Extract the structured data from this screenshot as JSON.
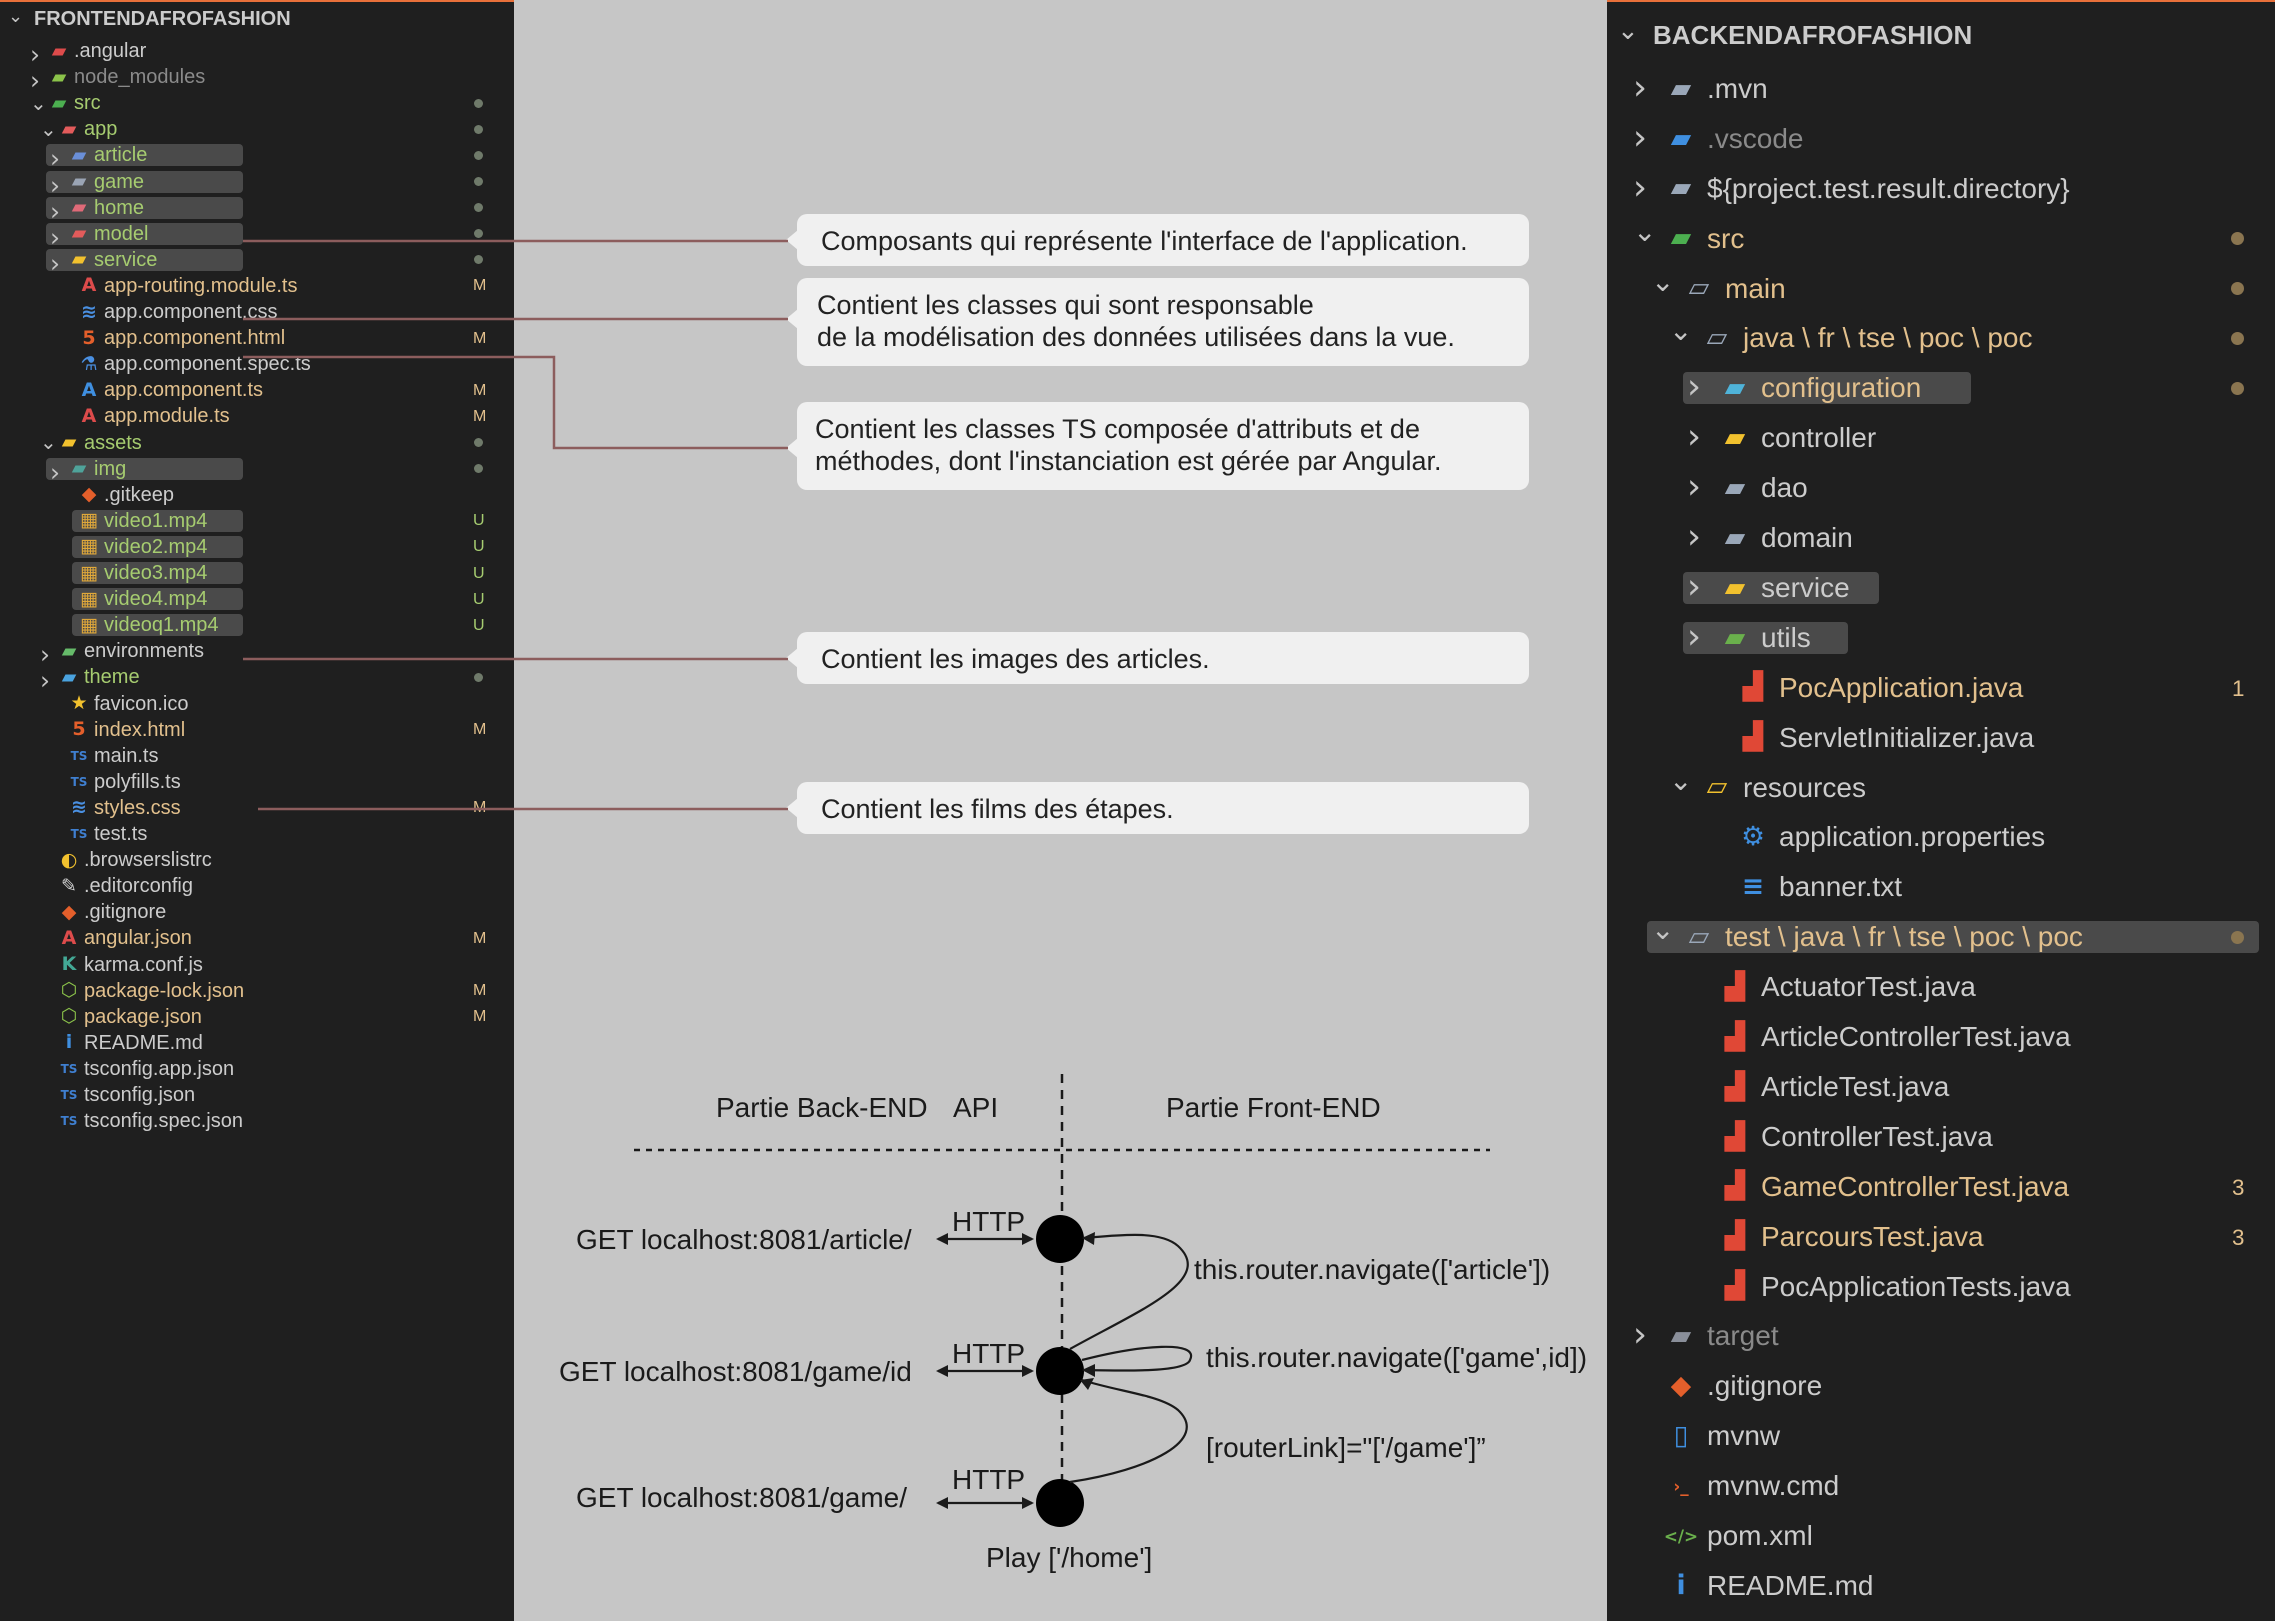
{
  "left_explorer": {
    "title": "FRONTENDAFROFASHION",
    "items": [
      {
        "label": ".angular",
        "indent": 1,
        "chevron": "right",
        "icon": "angular-folder-icon"
      },
      {
        "label": "node_modules",
        "indent": 1,
        "chevron": "right",
        "icon": "node-folder-icon",
        "dim": true
      },
      {
        "label": "src",
        "indent": 1,
        "chevron": "down",
        "icon": "src-folder-icon",
        "dot": true,
        "color": "#a6cc70"
      },
      {
        "label": "app",
        "indent": 2,
        "chevron": "down",
        "icon": "app-folder-icon",
        "dot": true,
        "color": "#a6cc70"
      },
      {
        "label": "article",
        "indent": 3,
        "chevron": "right",
        "icon": "article-folder-icon",
        "dot": true,
        "hl": true,
        "color": "#a6cc70"
      },
      {
        "label": "game",
        "indent": 3,
        "chevron": "right",
        "icon": "game-folder-icon",
        "dot": true,
        "hl": true,
        "color": "#a6cc70"
      },
      {
        "label": "home",
        "indent": 3,
        "chevron": "right",
        "icon": "home-folder-icon",
        "dot": true,
        "hl": true,
        "color": "#a6cc70"
      },
      {
        "label": "model",
        "indent": 3,
        "chevron": "right",
        "icon": "model-folder-icon",
        "dot": true,
        "hl": true,
        "color": "#a6cc70"
      },
      {
        "label": "service",
        "indent": 3,
        "chevron": "right",
        "icon": "service-folder-icon",
        "dot": true,
        "hl": true,
        "color": "#a6cc70"
      },
      {
        "label": "app-routing.module.ts",
        "indent": 4,
        "icon": "angular-icon",
        "badge": "M",
        "color": "#e2c08d"
      },
      {
        "label": "app.component.css",
        "indent": 4,
        "icon": "css-icon"
      },
      {
        "label": "app.component.html",
        "indent": 4,
        "icon": "html-icon",
        "badge": "M",
        "color": "#e2c08d"
      },
      {
        "label": "app.component.spec.ts",
        "indent": 4,
        "icon": "test-flask-icon"
      },
      {
        "label": "app.component.ts",
        "indent": 4,
        "icon": "angular-component-icon",
        "badge": "M",
        "color": "#e2c08d"
      },
      {
        "label": "app.module.ts",
        "indent": 4,
        "icon": "angular-icon",
        "badge": "M",
        "color": "#e2c08d"
      },
      {
        "label": "assets",
        "indent": 2,
        "chevron": "down",
        "icon": "assets-folder-icon",
        "dot": true,
        "color": "#a6cc70"
      },
      {
        "label": "img",
        "indent": 3,
        "chevron": "right",
        "icon": "images-folder-icon",
        "dot": true,
        "hl": true,
        "color": "#a6cc70"
      },
      {
        "label": ".gitkeep",
        "indent": 4,
        "icon": "git-icon"
      },
      {
        "label": "video1.mp4",
        "indent": 4,
        "icon": "video-icon",
        "badge": "U",
        "hl": true,
        "color": "#a6cc70"
      },
      {
        "label": "video2.mp4",
        "indent": 4,
        "icon": "video-icon",
        "badge": "U",
        "hl": true,
        "color": "#a6cc70"
      },
      {
        "label": "video3.mp4",
        "indent": 4,
        "icon": "video-icon",
        "badge": "U",
        "hl": true,
        "color": "#a6cc70"
      },
      {
        "label": "video4.mp4",
        "indent": 4,
        "icon": "video-icon",
        "badge": "U",
        "hl": true,
        "color": "#a6cc70"
      },
      {
        "label": "videoq1.mp4",
        "indent": 4,
        "icon": "video-icon",
        "badge": "U",
        "hl": true,
        "color": "#a6cc70"
      },
      {
        "label": "environments",
        "indent": 2,
        "chevron": "right",
        "icon": "environment-folder-icon"
      },
      {
        "label": "theme",
        "indent": 2,
        "chevron": "right",
        "icon": "theme-folder-icon",
        "dot": true,
        "color": "#a6cc70"
      },
      {
        "label": "favicon.ico",
        "indent": 3,
        "icon": "star-icon"
      },
      {
        "label": "index.html",
        "indent": 3,
        "icon": "html-icon",
        "badge": "M",
        "color": "#e2c08d"
      },
      {
        "label": "main.ts",
        "indent": 3,
        "icon": "typescript-icon"
      },
      {
        "label": "polyfills.ts",
        "indent": 3,
        "icon": "typescript-icon"
      },
      {
        "label": "styles.css",
        "indent": 3,
        "icon": "css-icon",
        "badge": "M",
        "color": "#e2c08d"
      },
      {
        "label": "test.ts",
        "indent": 3,
        "icon": "typescript-icon"
      },
      {
        "label": ".browserslistrc",
        "indent": 2,
        "icon": "browserslist-icon"
      },
      {
        "label": ".editorconfig",
        "indent": 2,
        "icon": "editorconfig-icon"
      },
      {
        "label": ".gitignore",
        "indent": 2,
        "icon": "git-icon"
      },
      {
        "label": "angular.json",
        "indent": 2,
        "icon": "angular-icon",
        "badge": "M",
        "color": "#e2c08d"
      },
      {
        "label": "karma.conf.js",
        "indent": 2,
        "icon": "karma-icon"
      },
      {
        "label": "package-lock.json",
        "indent": 2,
        "icon": "npm-icon",
        "badge": "M",
        "color": "#e2c08d"
      },
      {
        "label": "package.json",
        "indent": 2,
        "icon": "npm-icon",
        "badge": "M",
        "color": "#e2c08d"
      },
      {
        "label": "README.md",
        "indent": 2,
        "icon": "info-icon"
      },
      {
        "label": "tsconfig.app.json",
        "indent": 2,
        "icon": "tsconfig-icon"
      },
      {
        "label": "tsconfig.json",
        "indent": 2,
        "icon": "tsconfig-icon"
      },
      {
        "label": "tsconfig.spec.json",
        "indent": 2,
        "icon": "tsconfig-icon"
      }
    ]
  },
  "right_explorer": {
    "title": "BACKENDAFROFASHION",
    "items": [
      {
        "label": ".mvn",
        "indent": 1,
        "chevron": "right",
        "icon": "folder-icon"
      },
      {
        "label": ".vscode",
        "indent": 1,
        "chevron": "right",
        "icon": "vscode-folder-icon",
        "dim": true
      },
      {
        "label": "${project.test.result.directory}",
        "indent": 1,
        "chevron": "right",
        "icon": "folder-icon"
      },
      {
        "label": "src",
        "indent": 1,
        "chevron": "down",
        "icon": "src-folder-icon",
        "dot": true,
        "color": "#e2c08d"
      },
      {
        "label": "main",
        "indent": 2,
        "chevron": "down",
        "icon": "open-folder-icon",
        "dot": true,
        "color": "#e2c08d"
      },
      {
        "label": "java \\ fr \\ tse \\ poc \\ poc",
        "indent": 3,
        "chevron": "down",
        "icon": "open-folder-icon",
        "dot": true,
        "color": "#e2c08d"
      },
      {
        "label": "configuration",
        "indent": 4,
        "chevron": "right",
        "icon": "config-folder-icon",
        "dot": true,
        "hl": true,
        "color": "#e2c08d"
      },
      {
        "label": "controller",
        "indent": 4,
        "chevron": "right",
        "icon": "controller-folder-icon"
      },
      {
        "label": "dao",
        "indent": 4,
        "chevron": "right",
        "icon": "folder-icon"
      },
      {
        "label": "domain",
        "indent": 4,
        "chevron": "right",
        "icon": "folder-icon"
      },
      {
        "label": "service",
        "indent": 4,
        "chevron": "right",
        "icon": "service-folder-icon",
        "hl": true
      },
      {
        "label": "utils",
        "indent": 4,
        "chevron": "right",
        "icon": "utils-folder-icon",
        "hl": true
      },
      {
        "label": "PocApplication.java",
        "indent": 5,
        "icon": "java-icon",
        "badge": "1",
        "color": "#e2c08d"
      },
      {
        "label": "ServletInitializer.java",
        "indent": 5,
        "icon": "java-icon"
      },
      {
        "label": "resources",
        "indent": 3,
        "chevron": "down",
        "icon": "resources-folder-icon"
      },
      {
        "label": "application.properties",
        "indent": 5,
        "icon": "gear-icon"
      },
      {
        "label": "banner.txt",
        "indent": 5,
        "icon": "text-file-icon"
      },
      {
        "label": "test \\ java \\ fr \\ tse \\ poc \\ poc",
        "indent": 2,
        "chevron": "down",
        "icon": "open-folder-icon",
        "dot": true,
        "hl": true,
        "color": "#e2c08d"
      },
      {
        "label": "ActuatorTest.java",
        "indent": 4,
        "icon": "java-icon"
      },
      {
        "label": "ArticleControllerTest.java",
        "indent": 4,
        "icon": "java-icon"
      },
      {
        "label": "ArticleTest.java",
        "indent": 4,
        "icon": "java-icon"
      },
      {
        "label": "ControllerTest.java",
        "indent": 4,
        "icon": "java-icon"
      },
      {
        "label": "GameControllerTest.java",
        "indent": 4,
        "icon": "java-icon",
        "badge": "3",
        "color": "#e2c08d"
      },
      {
        "label": "ParcoursTest.java",
        "indent": 4,
        "icon": "java-icon",
        "badge": "3",
        "color": "#e2c08d"
      },
      {
        "label": "PocApplicationTests.java",
        "indent": 4,
        "icon": "java-icon"
      },
      {
        "label": "target",
        "indent": 1,
        "chevron": "right",
        "icon": "target-folder-icon",
        "dim": true
      },
      {
        "label": ".gitignore",
        "indent": 1,
        "icon": "git-icon"
      },
      {
        "label": "mvnw",
        "indent": 1,
        "icon": "file-icon"
      },
      {
        "label": "mvnw.cmd",
        "indent": 1,
        "icon": "terminal-icon"
      },
      {
        "label": "pom.xml",
        "indent": 1,
        "icon": "xml-icon"
      },
      {
        "label": "README.md",
        "indent": 1,
        "icon": "info-icon"
      }
    ]
  },
  "callouts": [
    {
      "lines": [
        "Composants qui représente l'interface de l'application."
      ]
    },
    {
      "lines": [
        "Contient les classes qui sont responsable",
        "de la modélisation des données utilisées dans la vue."
      ]
    },
    {
      "lines": [
        "Contient les classes TS composée d'attributs et de",
        "méthodes, dont l'instanciation est gérée par Angular."
      ]
    },
    {
      "lines": [
        "Contient les images des articles."
      ]
    },
    {
      "lines": [
        "Contient les films des étapes."
      ]
    }
  ],
  "diagram": {
    "back_label": "Partie Back-END",
    "api_label": "API",
    "front_label": "Partie Front-END",
    "requests": [
      {
        "url": "GET localhost:8081/article/",
        "protocol": "HTTP"
      },
      {
        "url": "GET localhost:8081/game/id",
        "protocol": "HTTP"
      },
      {
        "url": "GET localhost:8081/game/",
        "protocol": "HTTP"
      }
    ],
    "transitions": [
      "this.router.navigate(['article'])",
      "this.router.navigate(['game',id])",
      "[routerLink]=\"['/game']”"
    ],
    "start_label": "Play ['/home']"
  },
  "colors": {
    "sidebar_bg": "#1f1f1f",
    "canvas_bg": "#c6c6c6",
    "connector": "#8c5d5d",
    "modified": "#e2c08d",
    "untracked": "#a6cc70",
    "text": "#cccccc",
    "accent_border": "#e8703a"
  }
}
